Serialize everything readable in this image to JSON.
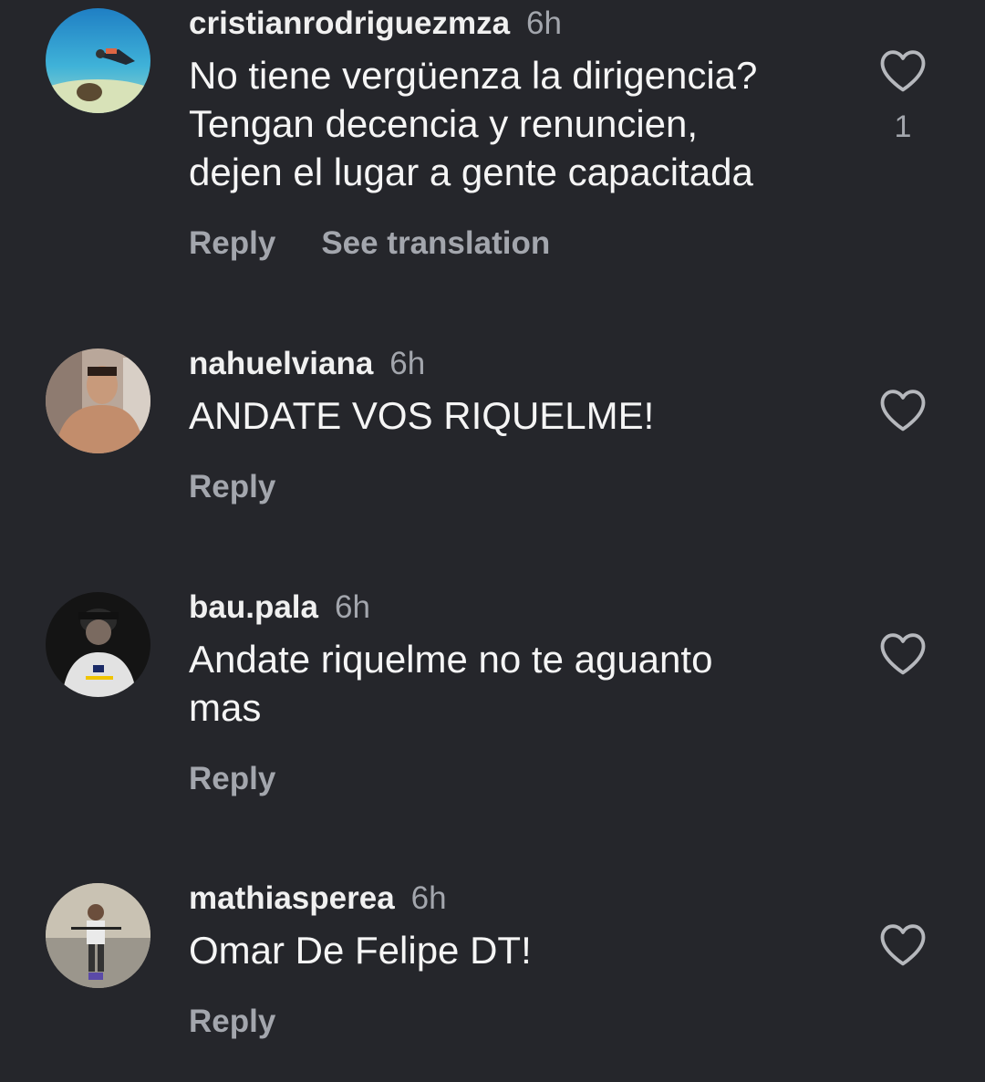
{
  "comments": [
    {
      "username": "cristianrodriguezmza",
      "time": "6h",
      "text": "No tiene vergüenza la dirigencia?\nTengan decencia y renuncien,\ndejen el lugar a gente capacitada",
      "reply_label": "Reply",
      "see_translation_label": "See translation",
      "like_count": "1"
    },
    {
      "username": "nahuelviana",
      "time": "6h",
      "text": "ANDATE VOS RIQUELME!",
      "reply_label": "Reply"
    },
    {
      "username": "bau.pala",
      "time": "6h",
      "text": "Andate riquelme no te aguanto\nmas",
      "reply_label": "Reply"
    },
    {
      "username": "mathiasperea",
      "time": "6h",
      "text": "Omar De Felipe DT!",
      "reply_label": "Reply"
    }
  ],
  "icons": {
    "like": "heart-outline-icon"
  },
  "colors": {
    "background": "#25262b",
    "secondary_text": "#a3a6ad",
    "primary_text": "#f5f5f5"
  }
}
